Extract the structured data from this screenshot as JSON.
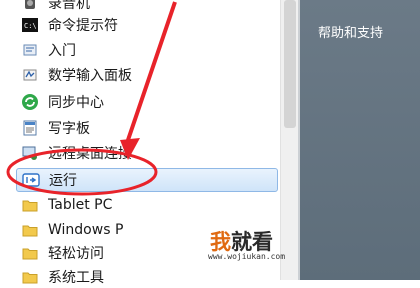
{
  "menu": {
    "items": [
      {
        "label": "录音机",
        "icon": "recorder-icon"
      },
      {
        "label": "命令提示符",
        "icon": "cmd-icon"
      },
      {
        "label": "入门",
        "icon": "getting-started-icon"
      },
      {
        "label": "数学输入面板",
        "icon": "math-input-icon"
      },
      {
        "label": "同步中心",
        "icon": "sync-center-icon"
      },
      {
        "label": "写字板",
        "icon": "wordpad-icon"
      },
      {
        "label": "远程桌面连接",
        "icon": "remote-desktop-icon"
      },
      {
        "label": "运行",
        "icon": "run-icon"
      },
      {
        "label": "Tablet PC",
        "icon": "folder-icon"
      },
      {
        "label": "Windows P",
        "icon": "folder-icon"
      },
      {
        "label": "轻松访问",
        "icon": "folder-icon"
      },
      {
        "label": "系统工具",
        "icon": "folder-icon"
      }
    ],
    "selected_label": "运行"
  },
  "right_panel": {
    "help_label": "帮助和支持"
  },
  "watermark": {
    "logo_part1": "我",
    "logo_part2": "就看",
    "url": "www.wojiukan.com"
  },
  "colors": {
    "annotation_red": "#e8232a",
    "selection_border": "#8fb8e6",
    "right_panel_bg": "#637381",
    "folder_yellow": "#f2c94c"
  }
}
